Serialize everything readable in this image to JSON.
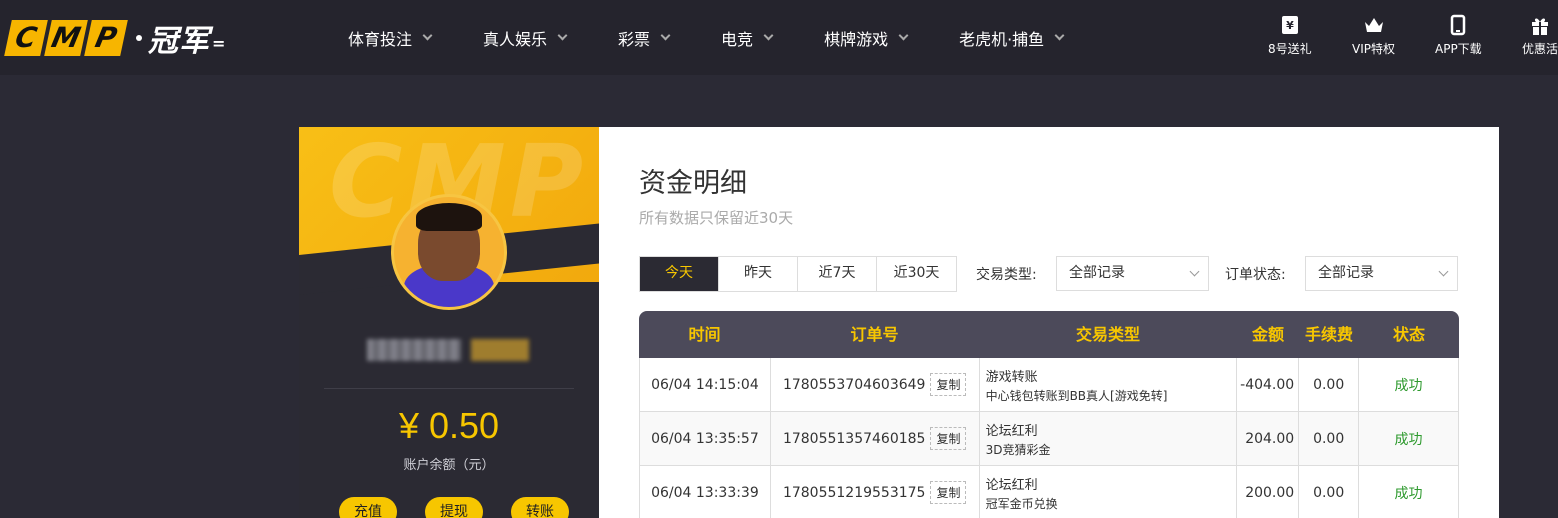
{
  "brand": {
    "letters": [
      "C",
      "M",
      "P"
    ],
    "cn_name": "冠军",
    "tail": "="
  },
  "nav": {
    "items": [
      {
        "label": "体育投注"
      },
      {
        "label": "真人娱乐"
      },
      {
        "label": "彩票"
      },
      {
        "label": "电竞"
      },
      {
        "label": "棋牌游戏"
      },
      {
        "label": "老虎机·捕鱼"
      }
    ]
  },
  "quick_links": [
    {
      "label": "8号送礼",
      "icon": "yen-ticket-icon"
    },
    {
      "label": "VIP特权",
      "icon": "crown-icon"
    },
    {
      "label": "APP下载",
      "icon": "phone-icon"
    },
    {
      "label": "优惠活",
      "icon": "gift-icon"
    }
  ],
  "user": {
    "watermark": "CMP",
    "balance": "¥ 0.50",
    "balance_label": "账户余额（元）",
    "actions": [
      "充值",
      "提现",
      "转账"
    ]
  },
  "page": {
    "title": "资金明细",
    "subtitle": "所有数据只保留近30天"
  },
  "filters": {
    "ranges": [
      "今天",
      "昨天",
      "近7天",
      "近30天"
    ],
    "active_range": "今天",
    "type_label": "交易类型:",
    "type_value": "全部记录",
    "status_label": "订单状态:",
    "status_value": "全部记录"
  },
  "table": {
    "headers": [
      "时间",
      "订单号",
      "交易类型",
      "金额",
      "手续费",
      "状态"
    ],
    "copy_label": "复制",
    "rows": [
      {
        "time": "06/04 14:15:04",
        "order": "1780553704603649",
        "type": "游戏转账",
        "detail": "中心钱包转账到BB真人[游戏免转]",
        "amount": "-404.00",
        "fee": "0.00",
        "status": "成功"
      },
      {
        "time": "06/04 13:35:57",
        "order": "1780551357460185",
        "type": "论坛红利",
        "detail": "3D竞猜彩金",
        "amount": "204.00",
        "fee": "0.00",
        "status": "成功"
      },
      {
        "time": "06/04 13:33:39",
        "order": "1780551219553175",
        "type": "论坛红利",
        "detail": "冠军金币兑换",
        "amount": "200.00",
        "fee": "0.00",
        "status": "成功"
      }
    ]
  },
  "colors": {
    "accent": "#f7c600",
    "dark": "#2b2a33",
    "success": "#2e9a2e"
  }
}
